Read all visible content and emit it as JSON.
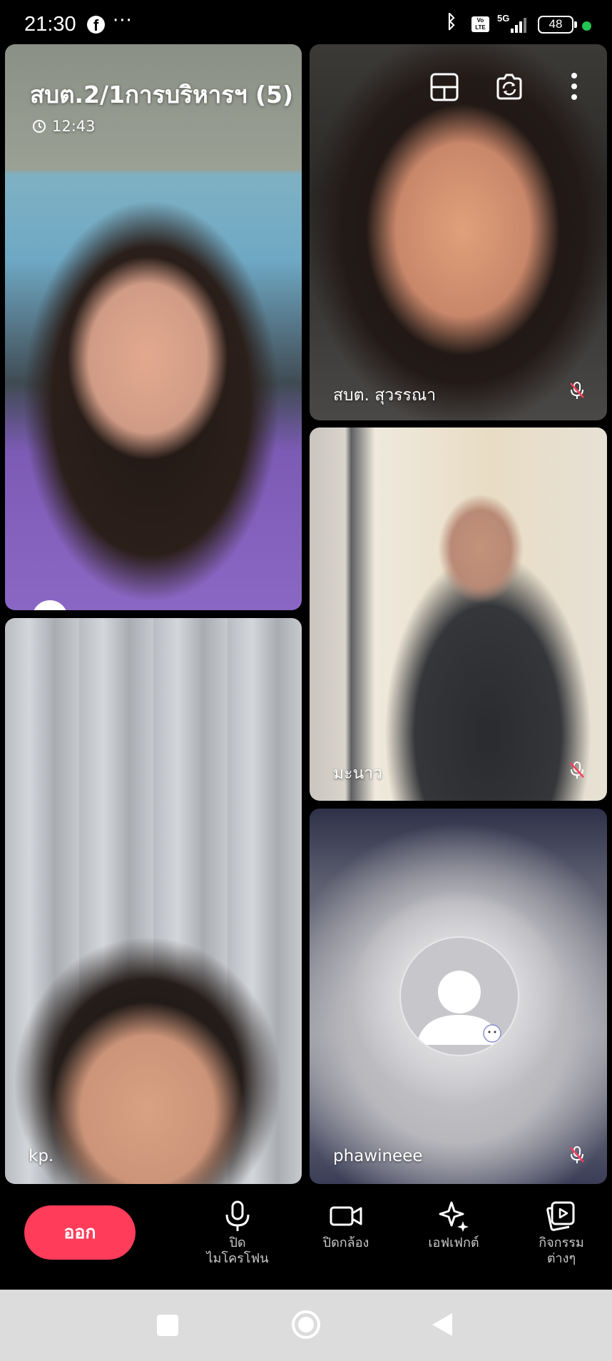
{
  "status_bar": {
    "time": "21:30",
    "facebook_icon": "f",
    "more": "···",
    "bluetooth_icon": "ᛒ",
    "volte": "Vo LTE",
    "network": "5G",
    "battery": "48"
  },
  "room": {
    "title": "สบต.2/1การบริหารฯ (5)",
    "elapsed": "12:43"
  },
  "participants": [
    {
      "name": "",
      "mic_muted": false
    },
    {
      "name": "สบต. สุวรรณา",
      "mic_muted": true
    },
    {
      "name": "มะนาว",
      "mic_muted": true
    },
    {
      "name": "kp.",
      "mic_muted": false
    },
    {
      "name": "phawineee",
      "mic_muted": true
    }
  ],
  "controls": {
    "leave": "ออก",
    "mic_line1": "ปิด",
    "mic_line2": "ไมโครโฟน",
    "camera": "ปิดกล้อง",
    "effects": "เอฟเฟกต์",
    "activities_line1": "กิจกรรม",
    "activities_line2": "ต่างๆ"
  },
  "colors": {
    "leave_button": "#ff3c5a",
    "online_dot": "#23c552"
  }
}
